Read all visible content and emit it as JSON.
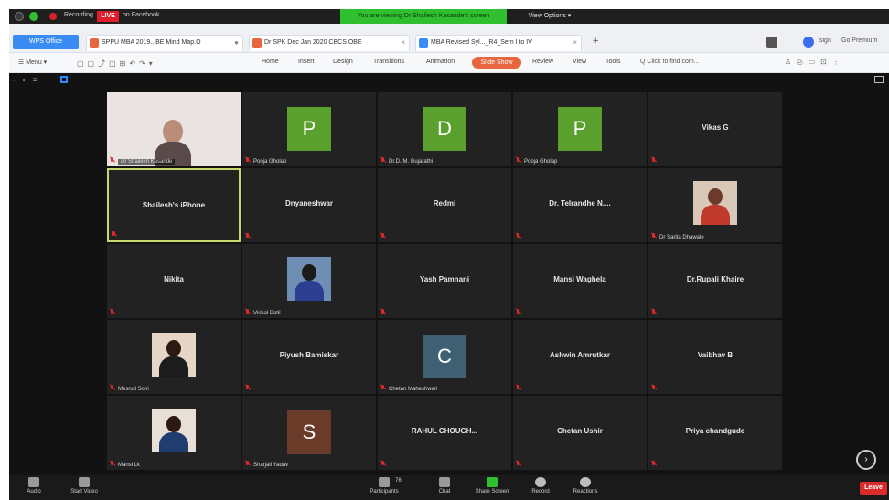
{
  "zoom_top": {
    "rec_text": "Recording",
    "live_badge": "LIVE",
    "live_text": "on Facebook",
    "viewing_banner": "You are viewing Dr Shailesh Kasande's screen",
    "view_options": "View Options ▾"
  },
  "tabs": {
    "wps": "WPS Office",
    "items": [
      {
        "label": "SPPU MBA 2019...BE Mind Map.O"
      },
      {
        "label": "Dr SPK Dec Jan 2020 CBCS OBE"
      },
      {
        "label": "MBA Revised Syl..._R4_Sem I to IV"
      }
    ],
    "add": "+",
    "right_sign": "sign",
    "right_premium": "Go Premium"
  },
  "ribbon": {
    "menu": "☰ Menu ▾",
    "tabs": [
      "Home",
      "Insert",
      "Design",
      "Transitions",
      "Animation"
    ],
    "slide_show": "Slide Show",
    "tabs_after": [
      "Review",
      "View",
      "Tools"
    ],
    "search": "Q Click to find com..."
  },
  "participants": [
    {
      "name": "",
      "label": "Dr Shailesh Kasande",
      "type": "video-host"
    },
    {
      "name": "",
      "label": "Pooja Gholap",
      "type": "avatar",
      "letter": "P",
      "color": "#5aa02c"
    },
    {
      "name": "",
      "label": "Dr.D. M. Gujarathi",
      "type": "avatar",
      "letter": "D",
      "color": "#5aa02c"
    },
    {
      "name": "",
      "label": "Pooja Gholap",
      "type": "avatar",
      "letter": "P",
      "color": "#5aa02c"
    },
    {
      "name": "Vikas G",
      "label": "",
      "type": "name"
    },
    {
      "name": "Shailesh's iPhone",
      "label": "",
      "type": "name",
      "active": true
    },
    {
      "name": "Dnyaneshwar",
      "label": "",
      "type": "name"
    },
    {
      "name": "Redmi",
      "label": "",
      "type": "name"
    },
    {
      "name": "Dr. Telrandhe N....",
      "label": "",
      "type": "name"
    },
    {
      "name": "",
      "label": "Dr Sarita Dhawale",
      "type": "photo",
      "head": "#6b3a2a",
      "body": "#c0392b",
      "bg": "#d9c7b8"
    },
    {
      "name": "Nikita",
      "label": "",
      "type": "name"
    },
    {
      "name": "",
      "label": "Vishal Patil",
      "type": "photo",
      "head": "#1b1b1b",
      "body": "#2c3e8f",
      "bg": "#6e8fb3"
    },
    {
      "name": "Yash Pamnani",
      "label": "",
      "type": "name"
    },
    {
      "name": "Mansi Waghela",
      "label": "",
      "type": "name"
    },
    {
      "name": "Dr.Rupali Khaire",
      "label": "",
      "type": "name"
    },
    {
      "name": "",
      "label": "Mesrud Soni",
      "type": "photo",
      "head": "#2a1a12",
      "body": "#1c1c1c",
      "bg": "#e6d6c7"
    },
    {
      "name": "Piyush Bamiskar",
      "label": "",
      "type": "name"
    },
    {
      "name": "",
      "label": "Chetan Maheshwari",
      "type": "avatar",
      "letter": "C",
      "color": "#3f5f73"
    },
    {
      "name": "Ashwin Amrutkar",
      "label": "",
      "type": "name"
    },
    {
      "name": "Vaibhav B",
      "label": "",
      "type": "name"
    },
    {
      "name": "",
      "label": "Mansi Lk",
      "type": "photo",
      "head": "#2a1a12",
      "body": "#1f3e6f",
      "bg": "#e8e0d6"
    },
    {
      "name": "",
      "label": "Sharjali Yadav",
      "type": "avatar",
      "letter": "S",
      "color": "#6b3b2a"
    },
    {
      "name": "RAHUL CHOUGH...",
      "label": "",
      "type": "name"
    },
    {
      "name": "Chetan Ushir",
      "label": "",
      "type": "name"
    },
    {
      "name": "Priya chandgude",
      "label": "",
      "type": "name"
    }
  ],
  "toolbar": {
    "audio": "Audio",
    "video": "Start Video",
    "participants": "Participants",
    "participants_count": "76",
    "chat": "Chat",
    "share": "Share Screen",
    "record": "Record",
    "reactions": "Reactions",
    "leave": "Leave"
  },
  "colors": {
    "meeting_bg": "#121212",
    "tile_bg": "#222222",
    "active_border": "#c9d66c",
    "leave_red": "#d92b2b",
    "zoom_blue": "#2d8cff"
  }
}
